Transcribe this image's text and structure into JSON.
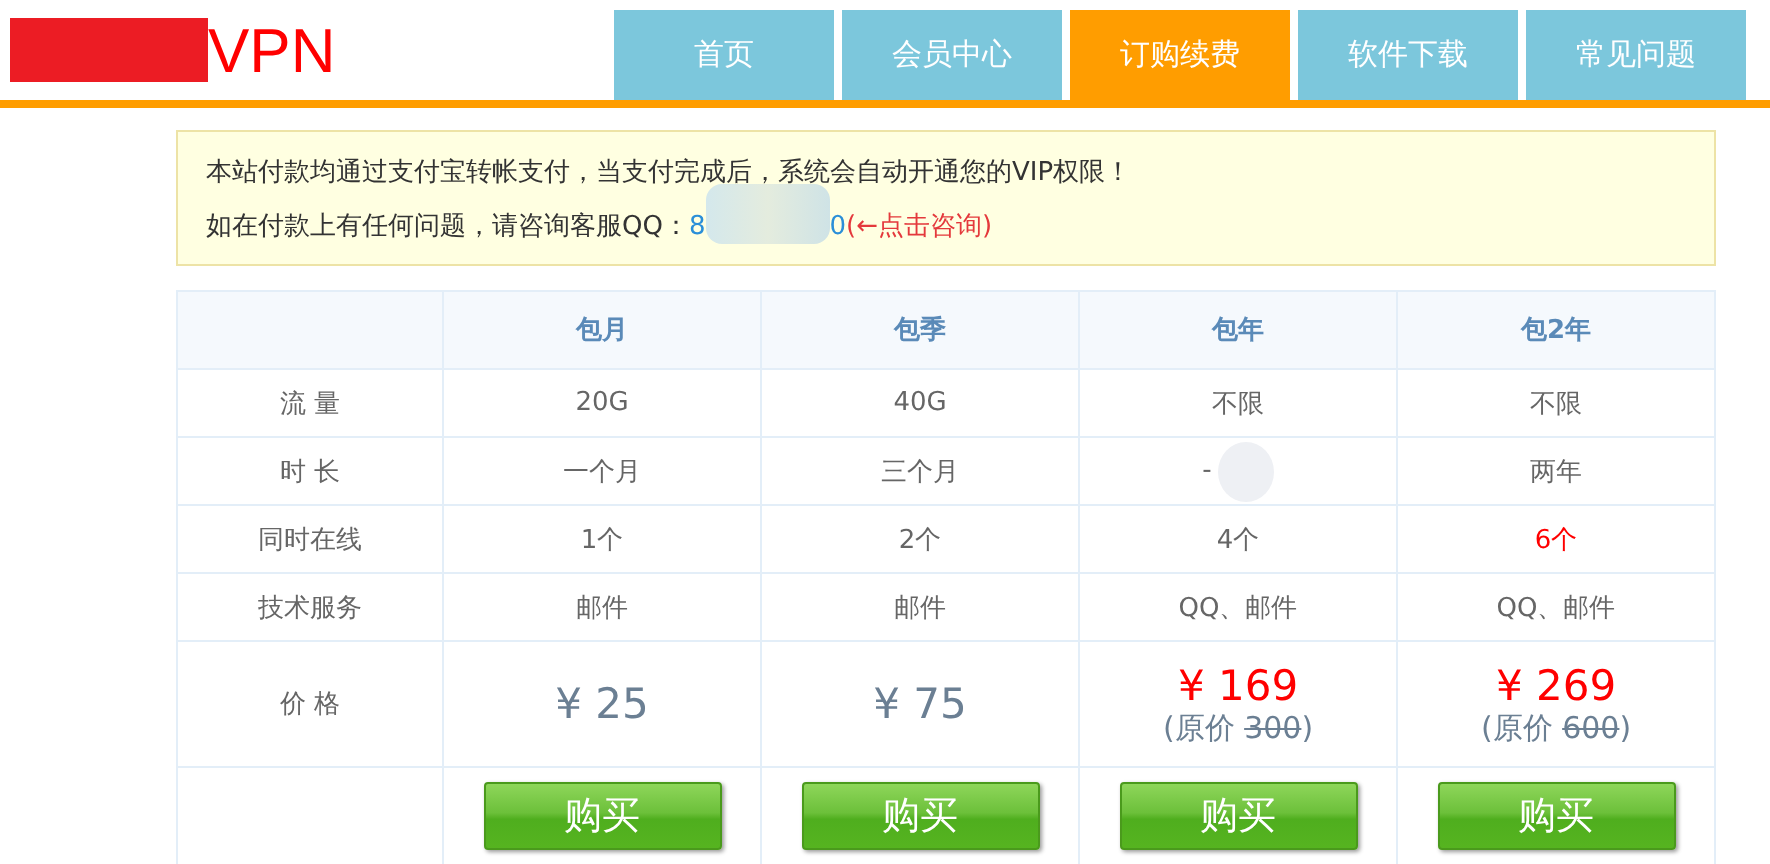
{
  "logo": {
    "text": "VPN"
  },
  "nav": [
    {
      "label": "首页",
      "selected": false
    },
    {
      "label": "会员中心",
      "selected": false
    },
    {
      "label": "订购续费",
      "selected": true
    },
    {
      "label": "软件下载",
      "selected": false
    },
    {
      "label": "常见问题",
      "selected": false
    }
  ],
  "notice": {
    "line1": "本站付款均通过支付宝转帐支付，当支付完成后，系统会自动开通您的VIP权限！",
    "line2": "如在付款上有任何问题，请咨询客服QQ：",
    "qq_start": "8",
    "qq_end": "0",
    "qq_hint": "(←点击咨询)"
  },
  "table": {
    "columns": [
      "包月",
      "包季",
      "包年",
      "包2年"
    ],
    "rows": [
      {
        "label": "流 量",
        "cells": [
          {
            "text": "20G",
            "highlight": false
          },
          {
            "text": "40G",
            "highlight": false
          },
          {
            "text": "不限",
            "highlight": false
          },
          {
            "text": "不限",
            "highlight": false
          }
        ]
      },
      {
        "label": "时 长",
        "cells": [
          {
            "text": "一个月",
            "highlight": false
          },
          {
            "text": "三个月",
            "highlight": false
          },
          {
            "text": "-",
            "highlight": false,
            "blurred": true
          },
          {
            "text": "两年",
            "highlight": false
          }
        ]
      },
      {
        "label": "同时在线",
        "cells": [
          {
            "text": "1个",
            "highlight": false
          },
          {
            "text": "2个",
            "highlight": false
          },
          {
            "text": "4个",
            "highlight": false
          },
          {
            "text": "6个",
            "highlight": true
          }
        ]
      },
      {
        "label": "技术服务",
        "cells": [
          {
            "text": "邮件",
            "highlight": false
          },
          {
            "text": "邮件",
            "highlight": false
          },
          {
            "text": "QQ、邮件",
            "highlight": false
          },
          {
            "text": "QQ、邮件",
            "highlight": false
          }
        ]
      }
    ],
    "price_label": "价 格",
    "prices": [
      {
        "price": "¥ 25",
        "discounted": false
      },
      {
        "price": "¥ 75",
        "discounted": false
      },
      {
        "price": "¥ 169",
        "discounted": true,
        "original_prefix": "(原价 ",
        "original": "300",
        "original_suffix": ")"
      },
      {
        "price": "¥ 269",
        "discounted": true,
        "original_prefix": "(原价 ",
        "original": "600",
        "original_suffix": ")"
      }
    ],
    "buy_buttons": [
      "购买",
      "购买",
      "购买",
      "购买"
    ]
  }
}
